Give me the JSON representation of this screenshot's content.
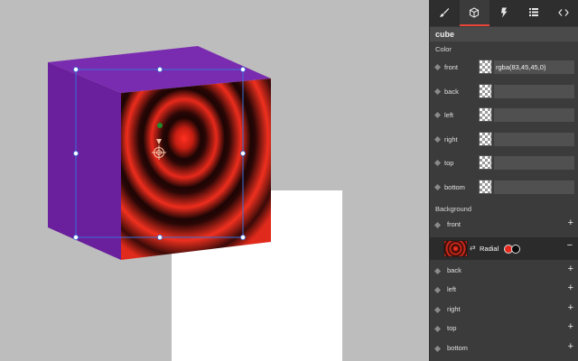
{
  "tabs": [
    {
      "icon": "brush-icon",
      "active": false
    },
    {
      "icon": "cube-icon",
      "active": true
    },
    {
      "icon": "bolt-icon",
      "active": false
    },
    {
      "icon": "list-icon",
      "active": false
    },
    {
      "icon": "code-icon",
      "active": false
    }
  ],
  "object": {
    "name": "cube"
  },
  "color_section": {
    "title": "Color",
    "rows": [
      {
        "label": "front",
        "value": "rgba(83,45,45,0)"
      },
      {
        "label": "back",
        "value": ""
      },
      {
        "label": "left",
        "value": ""
      },
      {
        "label": "right",
        "value": ""
      },
      {
        "label": "top",
        "value": ""
      },
      {
        "label": "bottom",
        "value": ""
      }
    ]
  },
  "background_section": {
    "title": "Background",
    "rows": [
      {
        "label": "front"
      },
      {
        "label": "back"
      },
      {
        "label": "left"
      },
      {
        "label": "right"
      },
      {
        "label": "top"
      },
      {
        "label": "bottom"
      }
    ],
    "layer": {
      "type": "Radial",
      "stop_colors": [
        "#e8281c",
        "#0a0a0a"
      ],
      "add_symbol": "+",
      "remove_symbol": "−",
      "swap_symbol": "⇄"
    }
  },
  "colors": {
    "cube_purple": "#6e22a0",
    "cube_top": "#7a2cb0",
    "gradient_red": "#ff2b1c",
    "gradient_dark": "#140403",
    "selection": "#3b6fd8",
    "accent": "#e8443a"
  }
}
